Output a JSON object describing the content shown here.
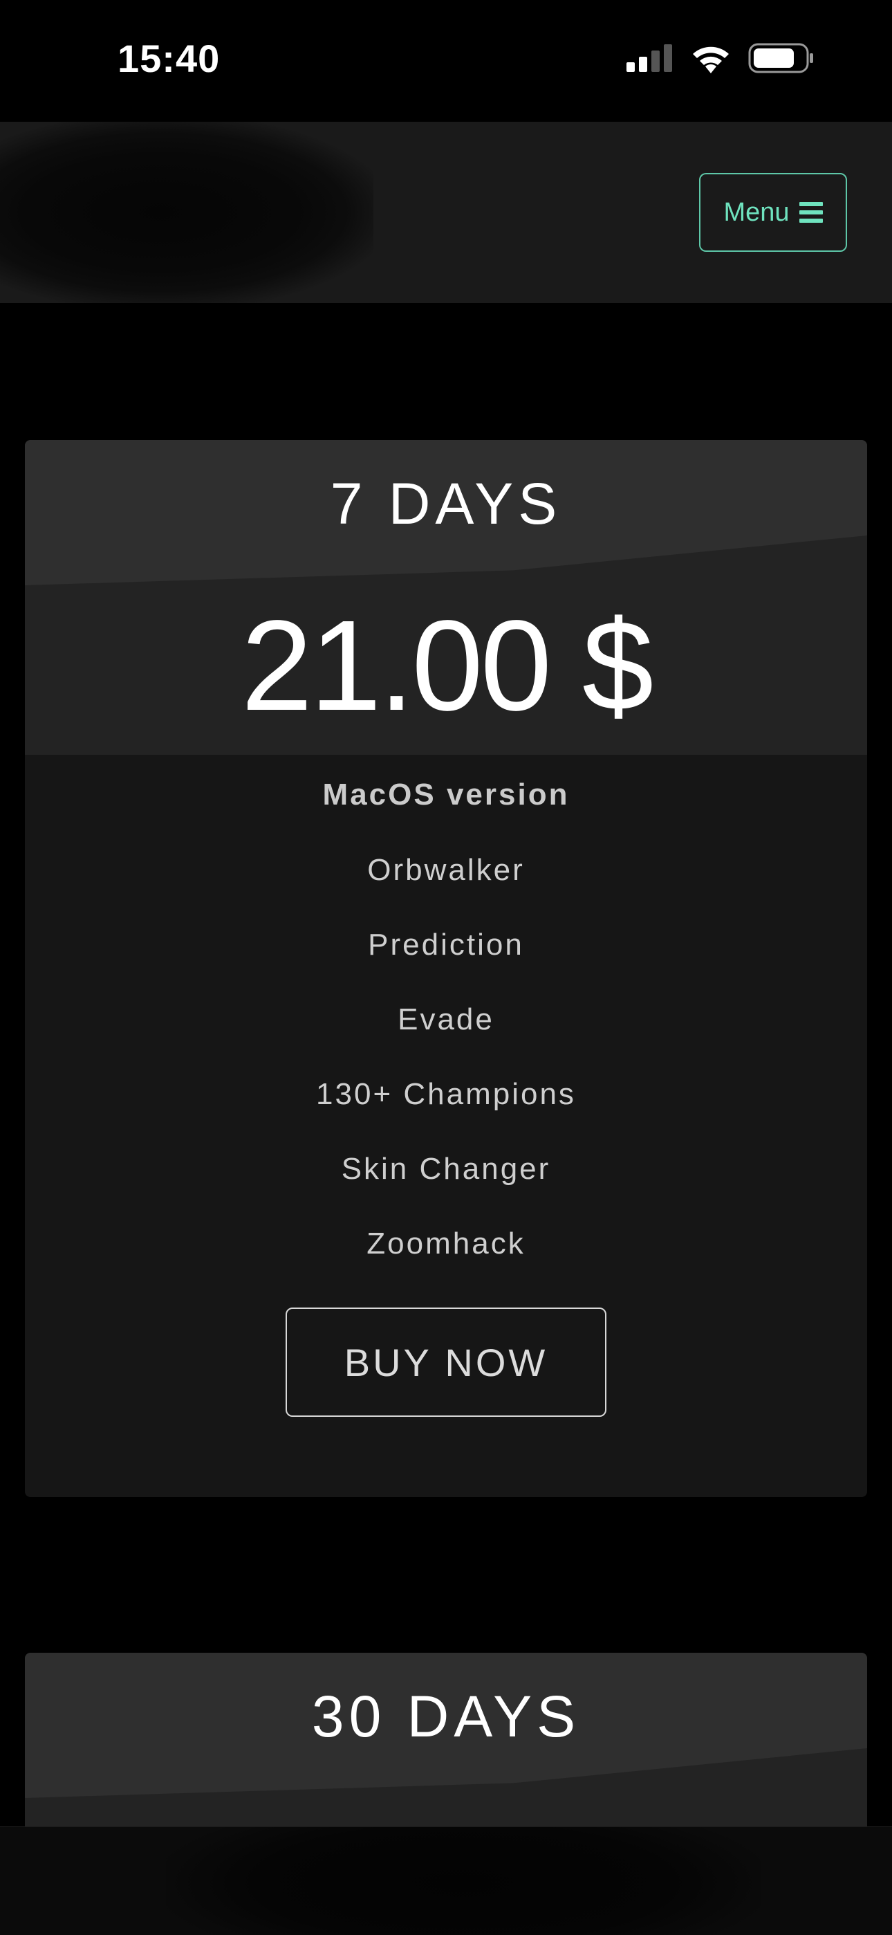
{
  "status_bar": {
    "time": "15:40"
  },
  "header": {
    "menu_label": "Menu"
  },
  "cards": [
    {
      "title": "7 DAYS",
      "price": "21.00 $",
      "features": [
        "MacOS version",
        "Orbwalker",
        "Prediction",
        "Evade",
        "130+ Champions",
        "Skin Changer",
        "Zoomhack"
      ],
      "button_label": "BUY NOW"
    },
    {
      "title": "30 DAYS"
    }
  ],
  "colors": {
    "accent": "#6fe3bf",
    "background": "#000000",
    "card": "#161616"
  },
  "icons": [
    "signal-icon",
    "wifi-icon",
    "battery-icon",
    "hamburger-icon"
  ]
}
